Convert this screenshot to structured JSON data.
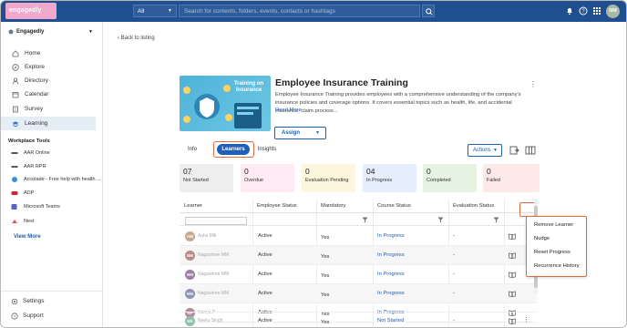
{
  "topbar": {
    "logo": "engagedly",
    "scope_label": "All",
    "search_placeholder": "Search for contents, folders, events, contacts or hashtags",
    "user_initials": "NM",
    "colors": {
      "bar": "#1f4f8f",
      "accent": "#1f5fb6"
    }
  },
  "sidebar": {
    "org_name": "Engagedly",
    "items": [
      {
        "label": "Home",
        "icon": "home-icon"
      },
      {
        "label": "Explore",
        "icon": "compass-icon"
      },
      {
        "label": "Directory",
        "icon": "people-icon"
      },
      {
        "label": "Calendar",
        "icon": "calendar-icon"
      },
      {
        "label": "Survey",
        "icon": "survey-icon"
      },
      {
        "label": "Learning",
        "icon": "graduation-cap-icon",
        "active": true
      }
    ],
    "workplace_tools_title": "Workplace Tools",
    "tools": [
      {
        "label": "AAR Online",
        "icon": "aar-online-icon"
      },
      {
        "label": "AAR RPR",
        "icon": "aar-rpr-icon"
      },
      {
        "label": "Accolade - Free help with health ...",
        "icon": "accolade-icon"
      },
      {
        "label": "ADP",
        "icon": "adp-icon"
      },
      {
        "label": "Microsoft Teams",
        "icon": "teams-icon"
      },
      {
        "label": "Nest",
        "icon": "nest-icon"
      }
    ],
    "view_more": "View More",
    "bottom": [
      {
        "label": "Settings",
        "icon": "gear-icon"
      },
      {
        "label": "Support",
        "icon": "help-icon"
      }
    ]
  },
  "main": {
    "back_label": "Back to listing",
    "training": {
      "thumbnail_text": "Training on Insurance",
      "title": "Employee Insurance Training",
      "description": "Employee Insurance Training provides employees with a comprehensive understanding of the company's insurance policies and coverage options. It covers essential topics such as health, life, and accidental insurance; claim process...",
      "read_more": "Read More",
      "assign_label": "Assign"
    },
    "tabs": [
      {
        "label": "Info",
        "selected": false
      },
      {
        "label": "Learners",
        "selected": true
      },
      {
        "label": "Insights",
        "selected": false
      }
    ],
    "actions_label": "Actions",
    "stats": [
      {
        "count": "07",
        "label": "Not Started",
        "color": "#eeeeee"
      },
      {
        "count": "0",
        "label": "Overdue",
        "color": "#fdeaf3"
      },
      {
        "count": "0",
        "label": "Evaluation Pending",
        "color": "#fdf5dc"
      },
      {
        "count": "04",
        "label": "In Progress",
        "color": "#e6eefb"
      },
      {
        "count": "0",
        "label": "Completed",
        "color": "#e6f3e3"
      },
      {
        "count": "0",
        "label": "Failed",
        "color": "#fde9e7"
      }
    ],
    "table": {
      "headers": [
        "Learner",
        "Employee Status",
        "Mandatory",
        "Course Status",
        "Evaluation Status"
      ],
      "rows": [
        {
          "initials": "AM",
          "name": "Ashu Mili",
          "employee_status": "Active",
          "mandatory": "Yes",
          "course_status": "In Progress",
          "evaluation_status": "-",
          "avatar_color": "#c7a98d"
        },
        {
          "initials": "NM",
          "name": "Nagashree MM",
          "employee_status": "Active",
          "mandatory": "Yes",
          "course_status": "In Progress",
          "evaluation_status": "-",
          "avatar_color": "#b98a8a"
        },
        {
          "initials": "NM",
          "name": "Nagashree MM",
          "employee_status": "Active",
          "mandatory": "Yes",
          "course_status": "In Progress",
          "evaluation_status": "-",
          "avatar_color": "#9d7ea4"
        },
        {
          "initials": "NM",
          "name": "Nagashree MM",
          "employee_status": "Active",
          "mandatory": "Yes",
          "course_status": "In Progress",
          "evaluation_status": "-",
          "avatar_color": "#8d94b5"
        },
        {
          "initials": "NP",
          "name": "Nanya P",
          "employee_status": "Active",
          "mandatory": "Yes",
          "course_status": "In Progress",
          "evaluation_status": "-",
          "avatar_color": "#b58aa0"
        },
        {
          "initials": "NS",
          "name": "Neetu Singh",
          "employee_status": "Active",
          "mandatory": "Yes",
          "course_status": "Not Started",
          "evaluation_status": "-",
          "avatar_color": "#8fc0a8"
        }
      ]
    },
    "row_menu": [
      "Remove Learner",
      "Nudge",
      "Reset Progress",
      "Recurrence History"
    ]
  }
}
